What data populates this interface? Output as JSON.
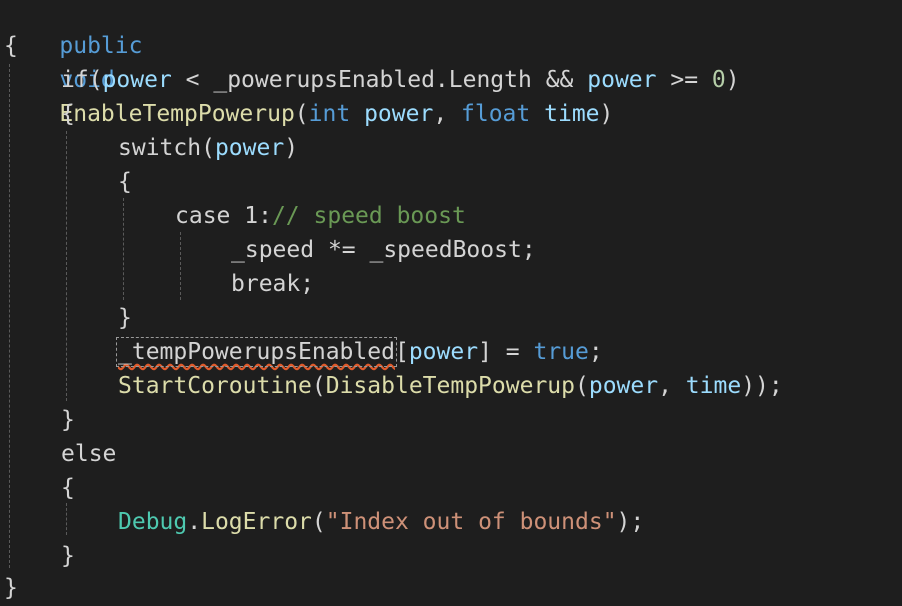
{
  "code": {
    "line1": {
      "kw_public": "public",
      "kw_void": "void",
      "fn_name": "EnableTempPowerup",
      "paren_open": "(",
      "kw_int": "int",
      "p1": "power",
      "comma": ", ",
      "kw_float": "float",
      "p2": "time",
      "paren_close": ")"
    },
    "line2": {
      "brace": "{"
    },
    "line3": {
      "kw_if": "if",
      "open": "(",
      "v1": "power",
      "op1": " < ",
      "v2": "_powerupsEnabled.Length",
      "op2": " && ",
      "v3": "power",
      "op3": " >= ",
      "num": "0",
      "close": ")"
    },
    "line4": {
      "brace": "{"
    },
    "line5": {
      "kw_switch": "switch",
      "open": "(",
      "v": "power",
      "close": ")"
    },
    "line6": {
      "brace": "{"
    },
    "line7": {
      "kw_case": "case",
      "num": " 1",
      "colon": ":",
      "comment": "// speed boost"
    },
    "line8": {
      "v1": "_speed",
      "op": " *= ",
      "v2": "_speedBoost",
      "semi": ";"
    },
    "line9": {
      "kw_break": "break",
      "semi": ";"
    },
    "line10": {
      "brace": "}"
    },
    "line11": {
      "v1": "_tempPowerupsEnabled",
      "bracket_open": "[",
      "v2": "power",
      "bracket_close": "]",
      "op": " = ",
      "kw_true": "true",
      "semi": ";"
    },
    "line12": {
      "fn1": "StartCoroutine",
      "open1": "(",
      "fn2": "DisableTempPowerup",
      "open2": "(",
      "v1": "power",
      "comma": ", ",
      "v2": "time",
      "close": "));"
    },
    "line13": {
      "brace": "}"
    },
    "line14": {
      "kw_else": "else"
    },
    "line15": {
      "brace": "{"
    },
    "line16": {
      "type": "Debug",
      "dot": ".",
      "fn": "LogError",
      "open": "(",
      "str": "\"Index out of bounds\"",
      "close": ");"
    },
    "line17": {
      "brace": "}"
    },
    "line18": {
      "brace": "}"
    }
  },
  "colors": {
    "background": "#1e1e1e",
    "keyword": "#569cd6",
    "function": "#dcdcaa",
    "variable": "#9cdcfe",
    "number": "#b5cea8",
    "string": "#ce9178",
    "comment": "#6a9955",
    "type": "#4ec9b0",
    "error_squiggle": "#e05a2b"
  }
}
